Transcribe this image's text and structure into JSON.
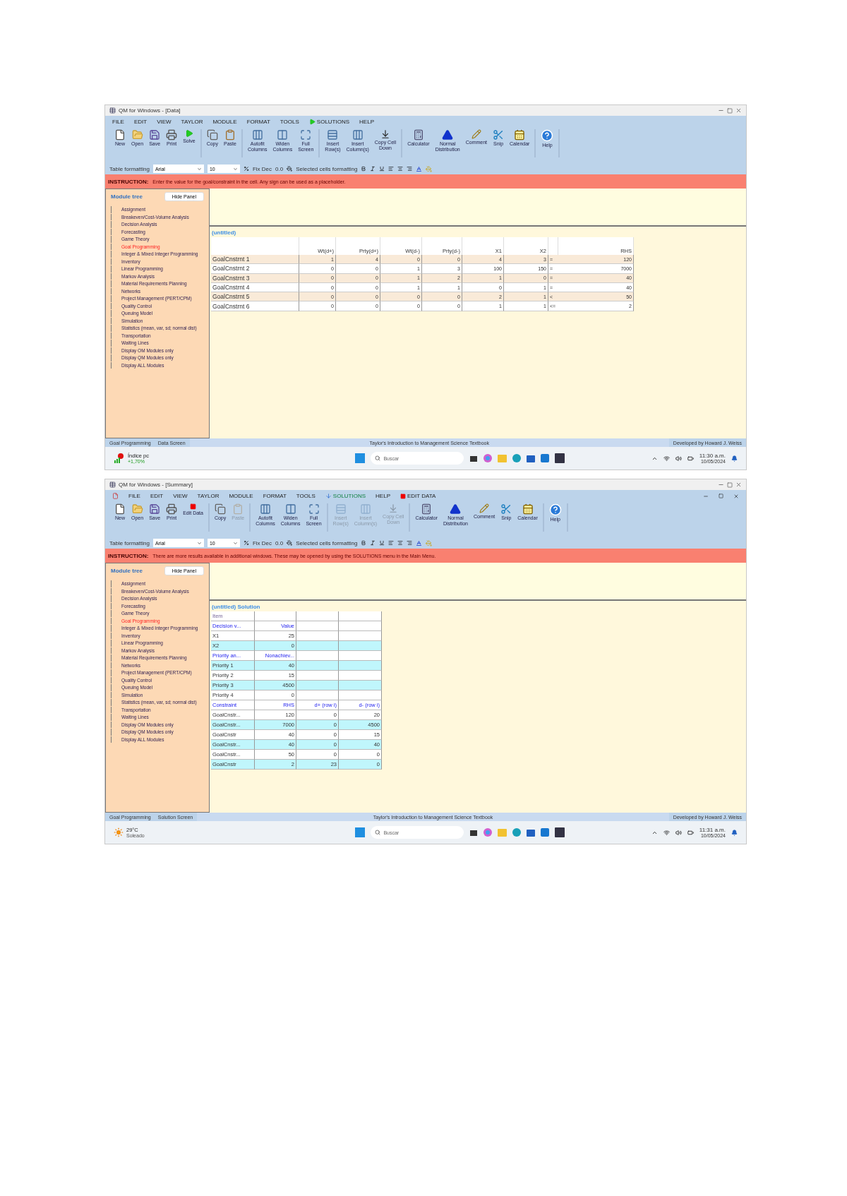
{
  "screenshots": [
    {
      "title": "QM for Windows - [Data]",
      "mdi_child": false,
      "menu": [
        {
          "label": "FILE",
          "kind": "plain"
        },
        {
          "label": "EDIT",
          "kind": "plain"
        },
        {
          "label": "VIEW",
          "kind": "plain"
        },
        {
          "label": "TAYLOR",
          "kind": "plain"
        },
        {
          "label": "MODULE",
          "kind": "plain"
        },
        {
          "label": "FORMAT",
          "kind": "plain"
        },
        {
          "label": "TOOLS",
          "kind": "plain"
        },
        {
          "label": "SOLUTIONS",
          "kind": "run"
        },
        {
          "label": "HELP",
          "kind": "plain"
        }
      ],
      "toolbar": [
        [
          {
            "label": "New",
            "kind": "new",
            "disabled": false
          },
          {
            "label": "Open",
            "kind": "open",
            "disabled": false
          },
          {
            "label": "Save",
            "kind": "save",
            "disabled": false
          },
          {
            "label": "Print",
            "kind": "print",
            "disabled": false
          },
          {
            "label": "Solve",
            "kind": "solve",
            "disabled": false
          }
        ],
        [
          {
            "label": "Copy",
            "kind": "copy",
            "disabled": false
          },
          {
            "label": "Paste",
            "kind": "paste",
            "disabled": false
          }
        ],
        [
          {
            "label": "Autofit\nColumns",
            "kind": "autofit",
            "disabled": false
          },
          {
            "label": "Widen\nColumns",
            "kind": "widen",
            "disabled": false
          },
          {
            "label": "Full\nScreen",
            "kind": "fullscreen",
            "disabled": false
          }
        ],
        [
          {
            "label": "Insert\nRow(s)",
            "kind": "insert_row",
            "disabled": false
          },
          {
            "label": "Insert\nColumn(s)",
            "kind": "insert_col",
            "disabled": false
          },
          {
            "label": "Copy Cell\nDown",
            "kind": "copy_down",
            "disabled": false
          }
        ],
        [
          {
            "label": "Calculator",
            "kind": "calculator",
            "disabled": false
          },
          {
            "label": "Normal\nDistribution",
            "kind": "normal",
            "disabled": false
          },
          {
            "label": "Comment",
            "kind": "comment",
            "disabled": false
          },
          {
            "label": "Snip",
            "kind": "snip",
            "disabled": false
          },
          {
            "label": "Calendar",
            "kind": "calendar",
            "disabled": false
          }
        ],
        [
          {
            "label": "Help",
            "kind": "help",
            "disabled": false
          }
        ]
      ],
      "format_bar": {
        "label": "Table formatting",
        "font": "Arial",
        "size": "10",
        "fix_dec": "Fix Dec",
        "decimals": "0.0",
        "selected_label": "Selected cells formatting"
      },
      "instruction": {
        "label": "INSTRUCTION:",
        "text": "Enter the value for the goal/constraint in the cell. Any sign can be used as a placeholder."
      },
      "module_tree": {
        "title": "Module tree",
        "button": "Hide Panel",
        "items": [
          {
            "label": "Assignment",
            "selected": false
          },
          {
            "label": "Breakeven/Cost-Volume Analysis",
            "selected": false
          },
          {
            "label": "Decision Analysis",
            "selected": false
          },
          {
            "label": "Forecasting",
            "selected": false
          },
          {
            "label": "Game Theory",
            "selected": false
          },
          {
            "label": "Goal Programming",
            "selected": true
          },
          {
            "label": "Integer & Mixed Integer Programming",
            "selected": false
          },
          {
            "label": "Inventory",
            "selected": false
          },
          {
            "label": "Linear Programming",
            "selected": false
          },
          {
            "label": "Markov Analysis",
            "selected": false
          },
          {
            "label": "Material Requirements Planning",
            "selected": false
          },
          {
            "label": "Networks",
            "selected": false
          },
          {
            "label": "Project Management (PERT/CPM)",
            "selected": false
          },
          {
            "label": "Quality Control",
            "selected": false
          },
          {
            "label": "Queuing Model",
            "selected": false
          },
          {
            "label": "Simulation",
            "selected": false
          },
          {
            "label": "Statistics (mean, var, sd; normal dist)",
            "selected": false
          },
          {
            "label": "Transportation",
            "selected": false
          },
          {
            "label": "Waiting Lines",
            "selected": false
          },
          {
            "label": "Display OM Modules only",
            "selected": false
          },
          {
            "label": "Display QM Modules only",
            "selected": false
          },
          {
            "label": "Display ALL Modules",
            "selected": false
          }
        ]
      },
      "data_table": {
        "caption": "(untitled)",
        "columns": [
          "Wt(d+)",
          "Prty(d+)",
          "Wt(d-)",
          "Prty(d-)",
          "X1",
          "X2",
          "RHS"
        ],
        "rows": [
          {
            "name": "GoalCnstrnt 1",
            "values": [
              "1",
              "4",
              "0",
              "0",
              "4",
              "3"
            ],
            "sign": "=",
            "rhs": "120"
          },
          {
            "name": "GoalCnstrnt 2",
            "values": [
              "0",
              "0",
              "1",
              "3",
              "100",
              "150"
            ],
            "sign": "=",
            "rhs": "7000"
          },
          {
            "name": "GoalCnstrnt 3",
            "values": [
              "0",
              "0",
              "1",
              "2",
              "1",
              "0"
            ],
            "sign": "=",
            "rhs": "40"
          },
          {
            "name": "GoalCnstrnt 4",
            "values": [
              "0",
              "0",
              "1",
              "1",
              "0",
              "1"
            ],
            "sign": "=",
            "rhs": "40"
          },
          {
            "name": "GoalCnstrnt 5",
            "values": [
              "0",
              "0",
              "0",
              "0",
              "2",
              "1"
            ],
            "sign": "<",
            "rhs": "50"
          },
          {
            "name": "GoalCnstrnt 6",
            "values": [
              "0",
              "0",
              "0",
              "0",
              "1",
              "1"
            ],
            "sign": "<=",
            "rhs": "2"
          }
        ]
      },
      "status_bar": [
        "Goal Programming",
        "Data Screen",
        "Taylor's Introduction to Management Science Textbook",
        "Developed by Howard J. Weiss"
      ],
      "taskbar": {
        "widget": {
          "kind": "market",
          "title": "Índice pc",
          "subtitle": "+1,70%"
        },
        "search": "Buscar",
        "time": "11:30 a.m.",
        "date": "10/05/2024"
      }
    },
    {
      "title": "QM for Windows - [Summary]",
      "mdi_child": true,
      "menu": [
        {
          "label": "FILE",
          "kind": "plain"
        },
        {
          "label": "EDIT",
          "kind": "plain"
        },
        {
          "label": "VIEW",
          "kind": "plain"
        },
        {
          "label": "TAYLOR",
          "kind": "plain"
        },
        {
          "label": "MODULE",
          "kind": "plain"
        },
        {
          "label": "FORMAT",
          "kind": "plain"
        },
        {
          "label": "TOOLS",
          "kind": "plain"
        },
        {
          "label": "SOLUTIONS",
          "kind": "down"
        },
        {
          "label": "HELP",
          "kind": "plain"
        },
        {
          "label": "EDIT DATA",
          "kind": "stop"
        }
      ],
      "toolbar": [
        [
          {
            "label": "New",
            "kind": "new",
            "disabled": false
          },
          {
            "label": "Open",
            "kind": "open",
            "disabled": false
          },
          {
            "label": "Save",
            "kind": "save",
            "disabled": false
          },
          {
            "label": "Print",
            "kind": "print",
            "disabled": false
          },
          {
            "label": "Edit Data",
            "kind": "edit",
            "disabled": false
          }
        ],
        [
          {
            "label": "Copy",
            "kind": "copy",
            "disabled": false
          },
          {
            "label": "Paste",
            "kind": "paste",
            "disabled": true
          }
        ],
        [
          {
            "label": "Autofit\nColumns",
            "kind": "autofit",
            "disabled": false
          },
          {
            "label": "Widen\nColumns",
            "kind": "widen",
            "disabled": false
          },
          {
            "label": "Full\nScreen",
            "kind": "fullscreen",
            "disabled": false
          }
        ],
        [
          {
            "label": "Insert\nRow(s)",
            "kind": "insert_row",
            "disabled": true
          },
          {
            "label": "Insert\nColumn(s)",
            "kind": "insert_col",
            "disabled": true
          },
          {
            "label": "Copy Cell\nDown",
            "kind": "copy_down",
            "disabled": true
          }
        ],
        [
          {
            "label": "Calculator",
            "kind": "calculator",
            "disabled": false
          },
          {
            "label": "Normal\nDistribution",
            "kind": "normal",
            "disabled": false
          },
          {
            "label": "Comment",
            "kind": "comment",
            "disabled": false
          },
          {
            "label": "Snip",
            "kind": "snip",
            "disabled": false
          },
          {
            "label": "Calendar",
            "kind": "calendar",
            "disabled": false
          }
        ],
        [
          {
            "label": "Help",
            "kind": "help",
            "disabled": false
          }
        ]
      ],
      "format_bar": {
        "label": "Table formatting",
        "font": "Arial",
        "size": "10",
        "fix_dec": "Fix Dec",
        "decimals": "0.0",
        "selected_label": "Selected cells formatting"
      },
      "instruction": {
        "label": "INSTRUCTION:",
        "text": "There are more results available in additional windows. These may be opened by using the SOLUTIONS menu in the Main Menu."
      },
      "module_tree": {
        "title": "Module tree",
        "button": "Hide Panel",
        "items": [
          {
            "label": "Assignment",
            "selected": false
          },
          {
            "label": "Breakeven/Cost-Volume Analysis",
            "selected": false
          },
          {
            "label": "Decision Analysis",
            "selected": false
          },
          {
            "label": "Forecasting",
            "selected": false
          },
          {
            "label": "Game Theory",
            "selected": false
          },
          {
            "label": "Goal Programming",
            "selected": true
          },
          {
            "label": "Integer & Mixed Integer Programming",
            "selected": false
          },
          {
            "label": "Inventory",
            "selected": false
          },
          {
            "label": "Linear Programming",
            "selected": false
          },
          {
            "label": "Markov Analysis",
            "selected": false
          },
          {
            "label": "Material Requirements Planning",
            "selected": false
          },
          {
            "label": "Networks",
            "selected": false
          },
          {
            "label": "Project Management (PERT/CPM)",
            "selected": false
          },
          {
            "label": "Quality Control",
            "selected": false
          },
          {
            "label": "Queuing Model",
            "selected": false
          },
          {
            "label": "Simulation",
            "selected": false
          },
          {
            "label": "Statistics (mean, var, sd; normal dist)",
            "selected": false
          },
          {
            "label": "Transportation",
            "selected": false
          },
          {
            "label": "Waiting Lines",
            "selected": false
          },
          {
            "label": "Display OM Modules only",
            "selected": false
          },
          {
            "label": "Display QM Modules only",
            "selected": false
          },
          {
            "label": "Display ALL Modules",
            "selected": false
          }
        ]
      },
      "solution_table": {
        "caption": "(untitled) Solution",
        "rows": [
          {
            "kind": "caption",
            "cells": [
              "Item"
            ]
          },
          {
            "kind": "header",
            "cells": [
              "Decision v...",
              "Value"
            ]
          },
          {
            "kind": "data",
            "cells": [
              "X1",
              "25"
            ]
          },
          {
            "kind": "data",
            "cells": [
              "X2",
              "0"
            ]
          },
          {
            "kind": "header",
            "cells": [
              "Priority an...",
              "Nonachiev..."
            ]
          },
          {
            "kind": "data",
            "cells": [
              "Priority 1",
              "40"
            ]
          },
          {
            "kind": "data",
            "cells": [
              "Priority 2",
              "15"
            ]
          },
          {
            "kind": "data",
            "cells": [
              "Priority 3",
              "4500"
            ]
          },
          {
            "kind": "data",
            "cells": [
              "Priority 4",
              "0"
            ]
          },
          {
            "kind": "header",
            "cells": [
              "Constraint",
              "RHS",
              "d+ (row i)",
              "d- (row i)"
            ]
          },
          {
            "kind": "data",
            "cells": [
              "GoalCnstr...",
              "120",
              "0",
              "20"
            ]
          },
          {
            "kind": "data",
            "cells": [
              "GoalCnstr...",
              "7000",
              "0",
              "4500"
            ]
          },
          {
            "kind": "data",
            "cells": [
              "GoalCnstr",
              "40",
              "0",
              "15"
            ]
          },
          {
            "kind": "data",
            "cells": [
              "GoalCnstr...",
              "40",
              "0",
              "40"
            ]
          },
          {
            "kind": "data",
            "cells": [
              "GoalCnstr...",
              "50",
              "0",
              "0"
            ]
          },
          {
            "kind": "data",
            "cells": [
              "GoalCnstr",
              "2",
              "23",
              "0"
            ]
          }
        ]
      },
      "status_bar": [
        "Goal Programming",
        "Solution Screen",
        "Taylor's Introduction to Management Science Textbook",
        "Developed by Howard J. Weiss"
      ],
      "taskbar": {
        "widget": {
          "kind": "weather",
          "title": "29°C",
          "subtitle": "Soleado"
        },
        "search": "Buscar",
        "time": "11:31 a.m.",
        "date": "10/05/2024"
      }
    }
  ]
}
